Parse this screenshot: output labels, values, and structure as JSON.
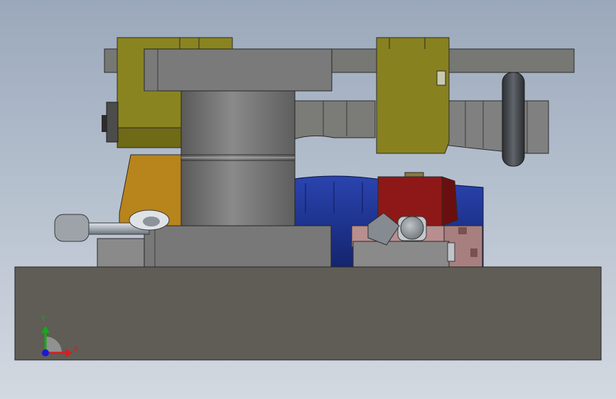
{
  "viewport": {
    "background_top": "#9aa8bb",
    "background_bottom": "#d3d9e1"
  },
  "triad": {
    "x_label": "X",
    "y_label": "Y",
    "x_color": "#d42020",
    "y_color": "#18a818",
    "z_color": "#1a1ad0"
  },
  "colors": {
    "base_plate": "#5f5d56",
    "gray_steel": "#7a7a7a",
    "olive_clamp": "#8a8420",
    "orange_block": "#b8841c",
    "blue_housing": "#1b2f8f",
    "red_block": "#8e1818",
    "pink_block": "#b88e8e"
  }
}
